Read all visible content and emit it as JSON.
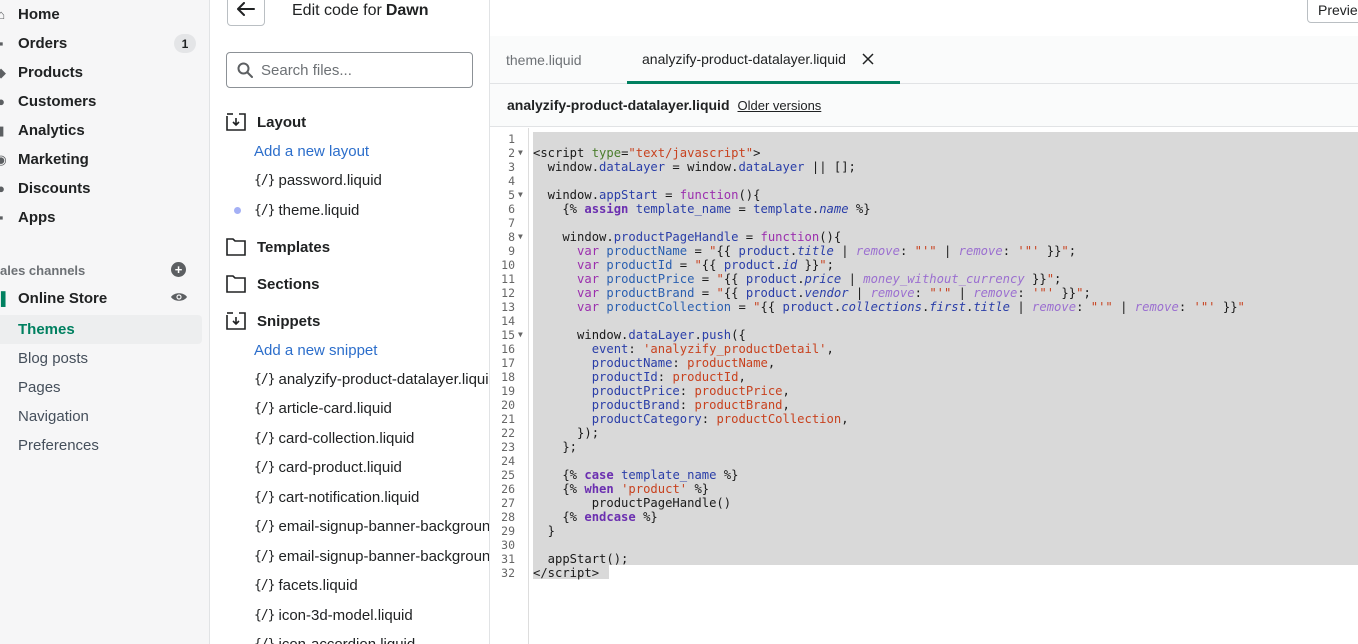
{
  "nav": {
    "items": [
      {
        "label": "Home",
        "icon": "home-icon"
      },
      {
        "label": "Orders",
        "icon": "orders-icon",
        "badge": "1"
      },
      {
        "label": "Products",
        "icon": "tag-icon"
      },
      {
        "label": "Customers",
        "icon": "person-icon"
      },
      {
        "label": "Analytics",
        "icon": "bar-chart-icon"
      },
      {
        "label": "Marketing",
        "icon": "target-icon"
      },
      {
        "label": "Discounts",
        "icon": "discount-icon"
      },
      {
        "label": "Apps",
        "icon": "apps-icon"
      }
    ],
    "sales_channels_label": "ales channels",
    "online_store_label": "Online Store",
    "sub_items": [
      "Themes",
      "Blog posts",
      "Pages",
      "Navigation",
      "Preferences"
    ]
  },
  "header": {
    "title_prefix": "Edit code for",
    "theme_name": "Dawn",
    "preview_label": "Previe"
  },
  "files": {
    "search_placeholder": "Search files...",
    "layout_label": "Layout",
    "add_layout": "Add a new layout",
    "layout_files": [
      "password.liquid",
      "theme.liquid"
    ],
    "templates_label": "Templates",
    "sections_label": "Sections",
    "snippets_label": "Snippets",
    "add_snippet": "Add a new snippet",
    "snippet_files": [
      "analyzify-product-datalayer.liquid",
      "article-card.liquid",
      "card-collection.liquid",
      "card-product.liquid",
      "cart-notification.liquid",
      "email-signup-banner-background.liquid",
      "email-signup-banner-background-mobile.liquid",
      "facets.liquid",
      "icon-3d-model.liquid",
      "icon-accordion.liquid"
    ],
    "file_glyph": "{/}"
  },
  "editor": {
    "tabs": [
      "theme.liquid",
      "analyzify-product-datalayer.liquid"
    ],
    "file_name": "analyzify-product-datalayer.liquid",
    "older_versions": "Older versions"
  }
}
